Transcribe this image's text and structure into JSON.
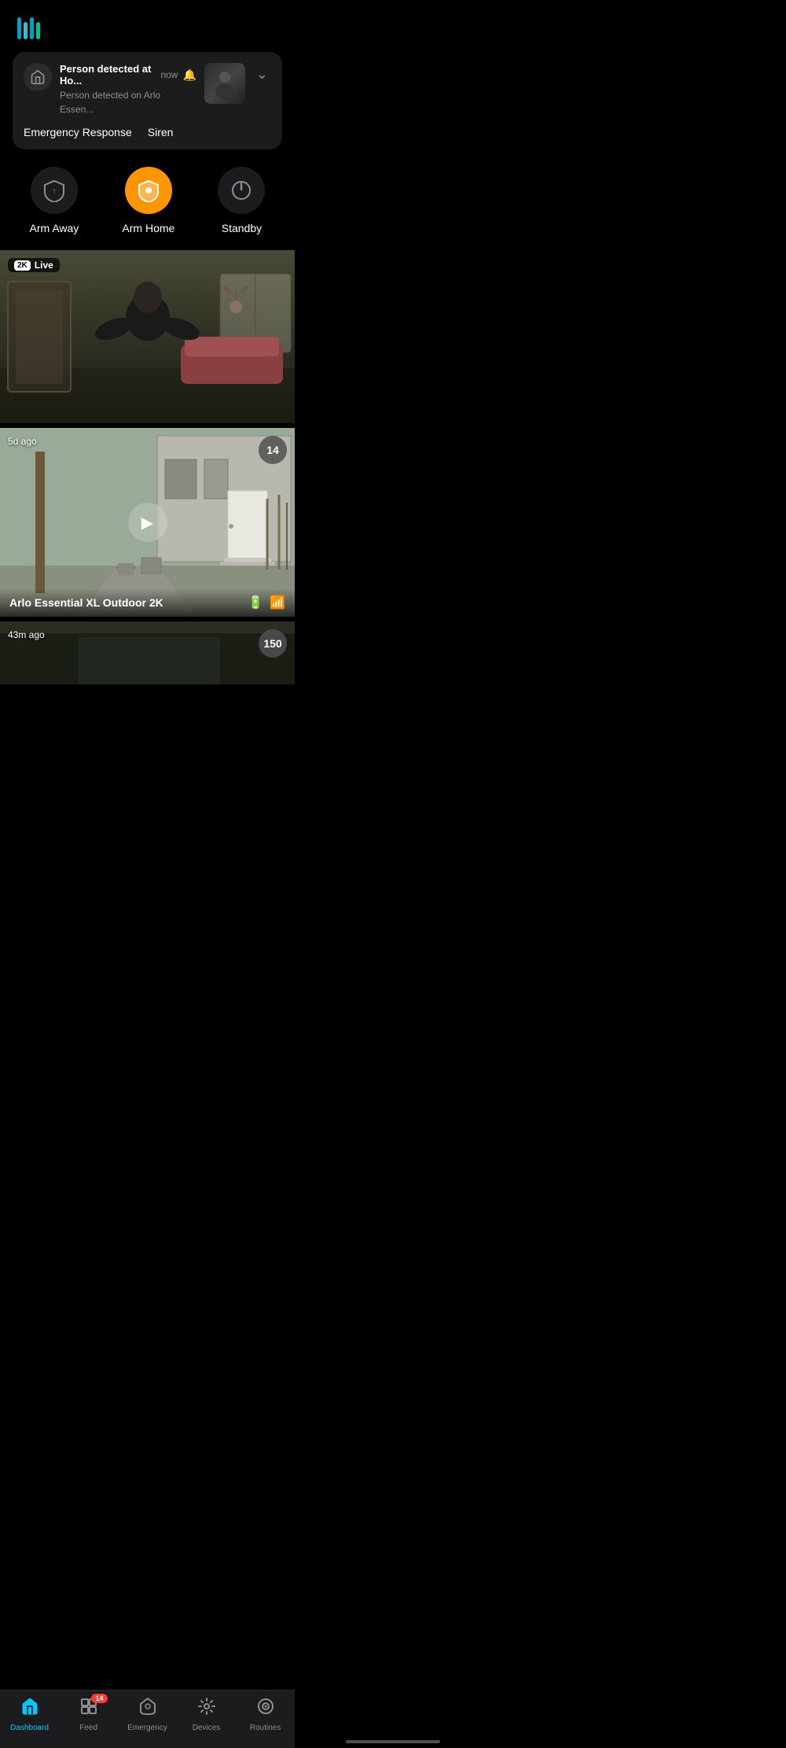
{
  "app": {
    "title": "Arlo"
  },
  "notification": {
    "title": "Person detected at Ho...",
    "time": "now",
    "description": "Person detected on Arlo Essen...",
    "actions": [
      {
        "label": "Emergency Response",
        "id": "emergency_response"
      },
      {
        "label": "Siren",
        "id": "siren"
      }
    ]
  },
  "modes": [
    {
      "label": "Arm Away",
      "id": "arm_away",
      "active": false
    },
    {
      "label": "Arm Home",
      "id": "arm_home",
      "active": true
    },
    {
      "label": "Standby",
      "id": "standby",
      "active": false
    }
  ],
  "feeds": [
    {
      "type": "live",
      "badge_2k": "2K",
      "badge_live": "Live"
    },
    {
      "type": "recorded",
      "time_ago": "5d ago",
      "clip_count": "14",
      "camera_name": "Arlo Essential XL Outdoor 2K"
    },
    {
      "type": "partial",
      "time_ago": "43m ago",
      "clip_count": "150"
    }
  ],
  "nav": {
    "items": [
      {
        "label": "Dashboard",
        "id": "dashboard",
        "active": true,
        "badge": null
      },
      {
        "label": "Feed",
        "id": "feed",
        "active": false,
        "badge": "14"
      },
      {
        "label": "Emergency",
        "id": "emergency",
        "active": false,
        "badge": null
      },
      {
        "label": "Devices",
        "id": "devices",
        "active": false,
        "badge": null
      },
      {
        "label": "Routines",
        "id": "routines",
        "active": false,
        "badge": null
      }
    ]
  }
}
